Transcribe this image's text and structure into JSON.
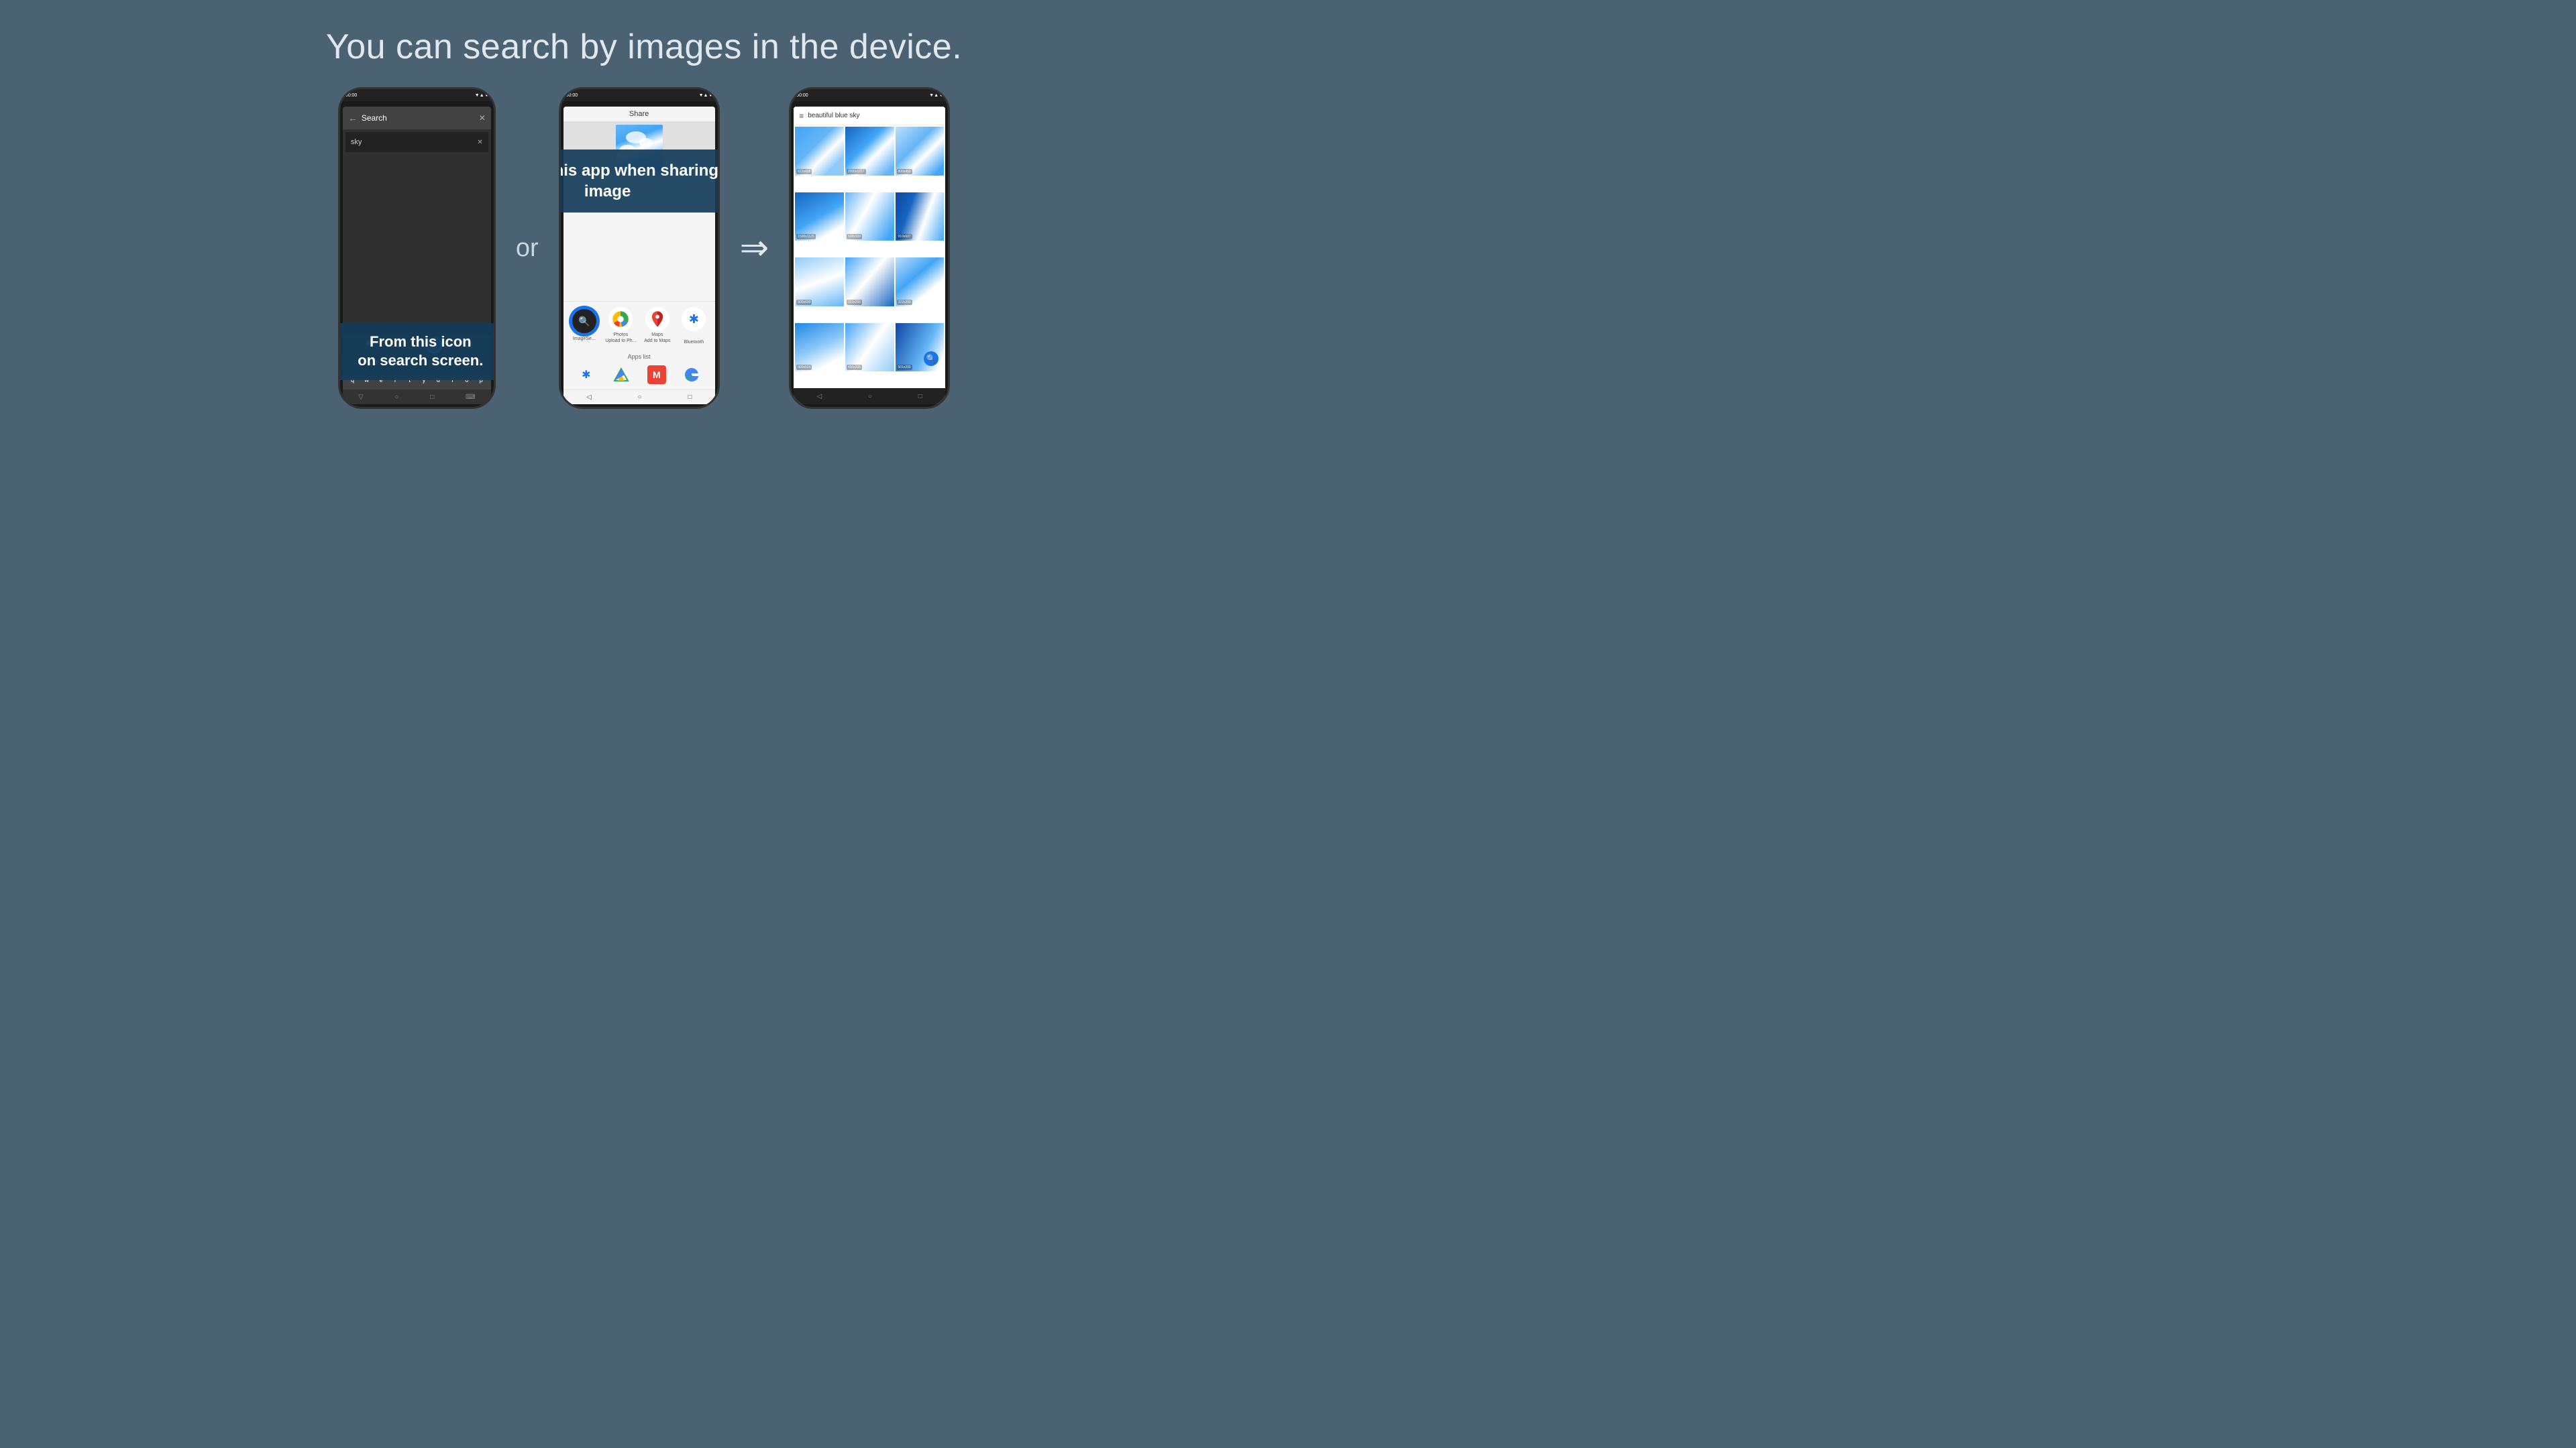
{
  "page": {
    "title": "You can search by images in the device.",
    "background_color": "#4a6272"
  },
  "phone1": {
    "status_time": "00:00",
    "search_placeholder": "Search",
    "search_query": "sky",
    "tooltip": {
      "line1": "From this icon",
      "line2": "on search screen."
    },
    "keyboard_keys": [
      "q",
      "w",
      "e",
      "r",
      "t",
      "y",
      "u",
      "i",
      "o",
      "p"
    ]
  },
  "phone2": {
    "status_time": "00:00",
    "share_title": "Share",
    "tooltip": {
      "line1": "Select this app when sharing image"
    },
    "apps": [
      {
        "name": "ImageSearch",
        "label": "ImageSe..."
      },
      {
        "name": "Photos",
        "label": "Photos\nUpload to Ph..."
      },
      {
        "name": "Maps",
        "label": "Maps\nAdd to Maps"
      },
      {
        "name": "Bluetooth",
        "label": "Bluetooth"
      }
    ],
    "apps_list_label": "Apps list"
  },
  "phone3": {
    "status_time": "00:00",
    "search_query": "beautiful blue sky",
    "grid_labels": [
      "612x408",
      "2000x1217",
      "800x451",
      "1500x1125",
      "508x339",
      "910x607",
      "600x600",
      "322x200",
      "322x200",
      "800x534",
      "450x200",
      "501x200"
    ]
  },
  "or_label": "or",
  "arrow_label": "⇒"
}
